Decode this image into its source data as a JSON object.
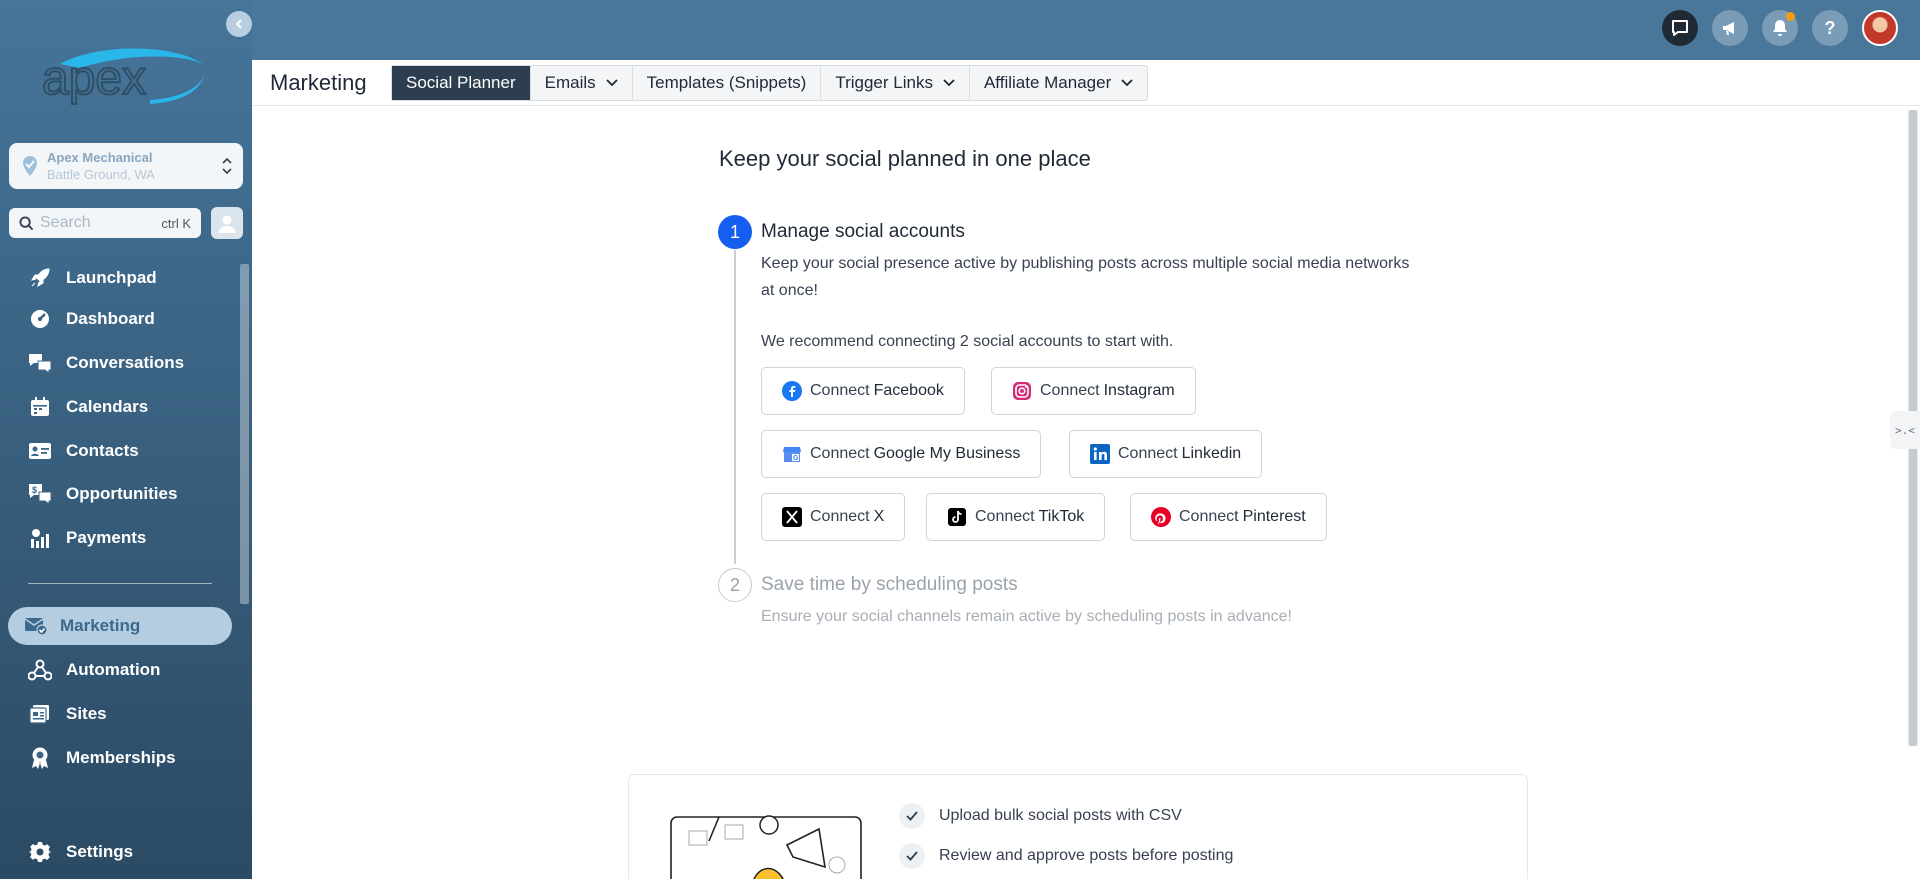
{
  "sidebar": {
    "brand": "apex",
    "location": {
      "name": "Apex Mechanical",
      "city": "Battle Ground, WA"
    },
    "search": {
      "placeholder": "Search",
      "shortcut": "ctrl K"
    },
    "nav": [
      {
        "label": "Launchpad",
        "icon": "rocket-icon"
      },
      {
        "label": "Dashboard",
        "icon": "gauge-icon"
      },
      {
        "label": "Conversations",
        "icon": "chat-icon"
      },
      {
        "label": "Calendars",
        "icon": "calendar-icon"
      },
      {
        "label": "Contacts",
        "icon": "contact-card-icon"
      },
      {
        "label": "Opportunities",
        "icon": "dollar-chat-icon"
      },
      {
        "label": "Payments",
        "icon": "payments-icon"
      },
      {
        "label": "Marketing",
        "icon": "mail-check-icon",
        "active": true
      },
      {
        "label": "Automation",
        "icon": "workflow-icon"
      },
      {
        "label": "Sites",
        "icon": "sites-icon"
      },
      {
        "label": "Memberships",
        "icon": "badge-icon"
      },
      {
        "label": "Settings",
        "icon": "gear-icon"
      }
    ]
  },
  "header": {
    "title": "Marketing",
    "tabs": [
      {
        "label": "Social Planner",
        "active": true,
        "dropdown": false
      },
      {
        "label": "Emails",
        "dropdown": true
      },
      {
        "label": "Templates (Snippets)",
        "dropdown": false
      },
      {
        "label": "Trigger Links",
        "dropdown": true
      },
      {
        "label": "Affiliate Manager",
        "dropdown": true
      }
    ]
  },
  "main": {
    "title": "Keep your social planned in one place",
    "step1": {
      "number": "1",
      "title": "Manage social accounts",
      "description": "Keep your social presence active by publishing posts across multiple social media networks at once!",
      "recommendation": "We recommend connecting 2 social accounts to start with."
    },
    "connect_prefix": "Connect",
    "buttons": [
      {
        "platform": "Facebook",
        "icon": "facebook-icon",
        "color": "#1877f2"
      },
      {
        "platform": "Instagram",
        "icon": "instagram-icon",
        "color": "#d62976"
      },
      {
        "platform": "Google My Business",
        "icon": "google-my-business-icon",
        "color": "#4285f4"
      },
      {
        "platform": "Linkedin",
        "icon": "linkedin-icon",
        "color": "#0a66c2"
      },
      {
        "platform": "X",
        "icon": "x-icon",
        "color": "#000000"
      },
      {
        "platform": "TikTok",
        "icon": "tiktok-icon",
        "color": "#000000"
      },
      {
        "platform": "Pinterest",
        "icon": "pinterest-icon",
        "color": "#e60023"
      }
    ],
    "step2": {
      "number": "2",
      "title": "Save time by scheduling posts",
      "description": "Ensure your social channels remain active by scheduling posts in advance!"
    },
    "features": [
      "Upload bulk social posts with CSV",
      "Review and approve posts before posting"
    ]
  },
  "colors": {
    "sidebar_top": "#46759a",
    "sidebar_bottom": "#2b4a63",
    "topbar": "#48779a",
    "primary": "#155eef",
    "tab_active": "#2c3e50"
  }
}
